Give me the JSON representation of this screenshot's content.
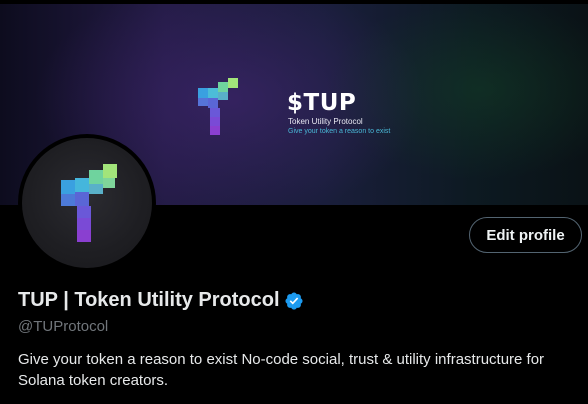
{
  "banner": {
    "ticker": "$TUP",
    "name": "Token Utility Protocol",
    "tagline": "Give your token a reason to exist",
    "logo_icon": "tup-cube-logo-icon"
  },
  "avatar": {
    "logo_icon": "tup-cube-logo-icon"
  },
  "actions": {
    "edit_profile_label": "Edit profile"
  },
  "profile": {
    "display_name": "TUP | Token Utility Protocol",
    "verified_icon": "verified-badge-icon",
    "handle": "@TUProtocol",
    "bio": "Give your token a reason to exist No-code social, trust & utility infrastructure for Solana token creators."
  },
  "colors": {
    "background": "#000000",
    "text_primary": "#e7e9ea",
    "text_secondary": "#71767b",
    "verified_blue": "#1d9bf0",
    "button_border": "#536471"
  }
}
